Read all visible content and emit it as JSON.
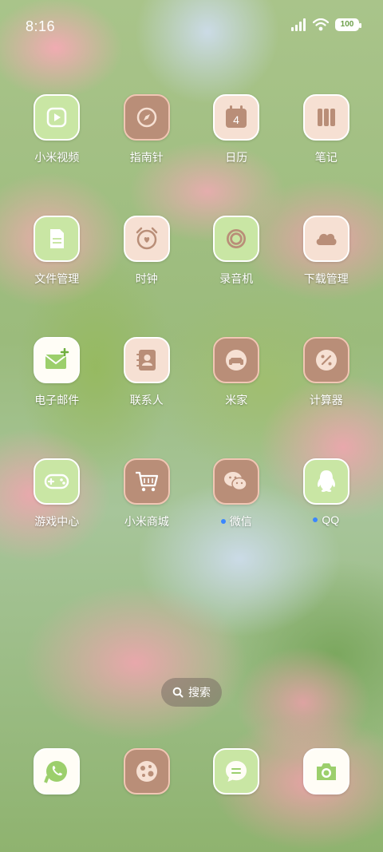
{
  "status": {
    "time": "8:16",
    "battery": "100"
  },
  "apps": [
    {
      "label": "小米视频",
      "icon": "video-play-icon",
      "style": "green",
      "dot": false
    },
    {
      "label": "指南针",
      "icon": "compass-icon",
      "style": "brown",
      "dot": false
    },
    {
      "label": "日历",
      "icon": "calendar-icon",
      "style": "peach",
      "dot": false,
      "icon_text": "4"
    },
    {
      "label": "笔记",
      "icon": "notes-icon",
      "style": "peach",
      "dot": false
    },
    {
      "label": "文件管理",
      "icon": "file-icon",
      "style": "green",
      "dot": false
    },
    {
      "label": "时钟",
      "icon": "alarm-clock-icon",
      "style": "peach",
      "dot": false
    },
    {
      "label": "录音机",
      "icon": "recorder-icon",
      "style": "green",
      "dot": false
    },
    {
      "label": "下载管理",
      "icon": "cloud-download-icon",
      "style": "peach",
      "dot": false
    },
    {
      "label": "电子邮件",
      "icon": "email-icon",
      "style": "white",
      "dot": false
    },
    {
      "label": "联系人",
      "icon": "contacts-icon",
      "style": "peach",
      "dot": false
    },
    {
      "label": "米家",
      "icon": "sofa-home-icon",
      "style": "brown",
      "dot": false
    },
    {
      "label": "计算器",
      "icon": "calculator-icon",
      "style": "brown",
      "dot": false
    },
    {
      "label": "游戏中心",
      "icon": "gamepad-icon",
      "style": "green",
      "dot": false
    },
    {
      "label": "小米商城",
      "icon": "shopping-cart-icon",
      "style": "brown",
      "dot": false
    },
    {
      "label": "微信",
      "icon": "wechat-icon",
      "style": "brown",
      "dot": true
    },
    {
      "label": "QQ",
      "icon": "qq-penguin-icon",
      "style": "green",
      "dot": true
    }
  ],
  "search": {
    "label": "搜索"
  },
  "dock": [
    {
      "icon": "phone-icon",
      "style": "white"
    },
    {
      "icon": "browser-icon",
      "style": "brown"
    },
    {
      "icon": "messages-icon",
      "style": "green"
    },
    {
      "icon": "camera-icon",
      "style": "white"
    }
  ],
  "colors": {
    "brown_icon": "#b98e78",
    "green_icon": "#c9e6a4",
    "peach_icon": "#f6e0d3",
    "notification_dot": "#3a86ff"
  }
}
